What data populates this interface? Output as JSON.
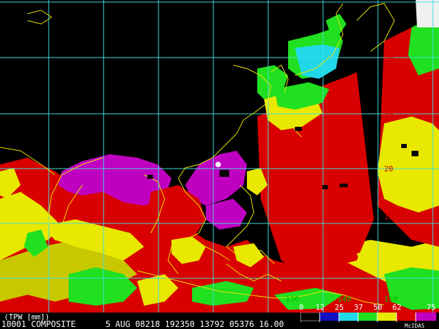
{
  "map": {
    "latitude_labels": [
      "40",
      "30",
      "20",
      "10"
    ],
    "longitude_labels": [
      "130",
      "140",
      "150"
    ],
    "grid_color": "#40e0e0",
    "coastline_color": "#e8e800"
  },
  "legend": {
    "product": "(TPW [mm])",
    "ticks": [
      "0",
      "12",
      "25",
      "37",
      "50",
      "62",
      "75"
    ],
    "colors": [
      "#000000",
      "#1010c0",
      "#20d8e8",
      "#20e020",
      "#e8e800",
      "#d80000",
      "#c000c0"
    ]
  },
  "footer": {
    "text": "10001 COMPOSITE      5 AUG 08218 192350 13792 05376 16.00",
    "software": "McIDAS"
  }
}
